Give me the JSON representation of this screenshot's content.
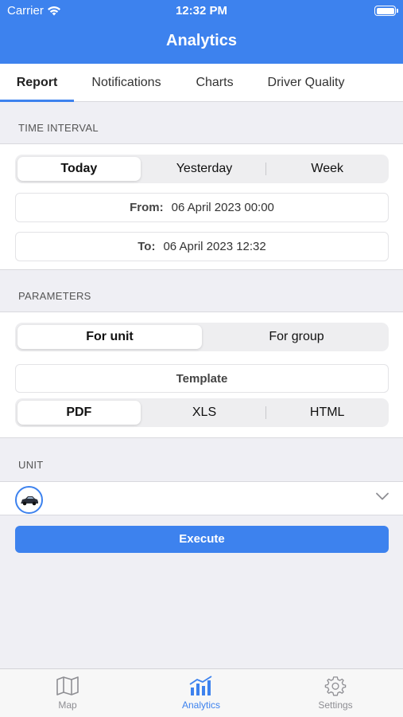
{
  "status_bar": {
    "carrier": "Carrier",
    "time": "12:32 PM"
  },
  "header": {
    "title": "Analytics"
  },
  "tabs": [
    {
      "label": "Report",
      "active": true
    },
    {
      "label": "Notifications",
      "active": false
    },
    {
      "label": "Charts",
      "active": false
    },
    {
      "label": "Driver Quality",
      "active": false
    }
  ],
  "time_interval": {
    "section_label": "TIME INTERVAL",
    "segments": [
      "Today",
      "Yesterday",
      "Week"
    ],
    "selected": "Today",
    "from_label": "From:",
    "from_value": "06 April 2023 00:00",
    "to_label": "To:",
    "to_value": "06 April 2023 12:32"
  },
  "parameters": {
    "section_label": "PARAMETERS",
    "scope_segments": [
      "For unit",
      "For group"
    ],
    "scope_selected": "For unit",
    "template_label": "Template",
    "format_segments": [
      "PDF",
      "XLS",
      "HTML"
    ],
    "format_selected": "PDF"
  },
  "unit": {
    "section_label": "UNIT",
    "avatar_icon": "car-icon",
    "dropdown_icon": "chevron-down-icon"
  },
  "execute_label": "Execute",
  "tab_bar": [
    {
      "label": "Map",
      "icon": "map-icon",
      "active": false
    },
    {
      "label": "Analytics",
      "icon": "analytics-icon",
      "active": true
    },
    {
      "label": "Settings",
      "icon": "gear-icon",
      "active": false
    }
  ],
  "colors": {
    "accent": "#3d82ee",
    "background": "#efeff4"
  }
}
